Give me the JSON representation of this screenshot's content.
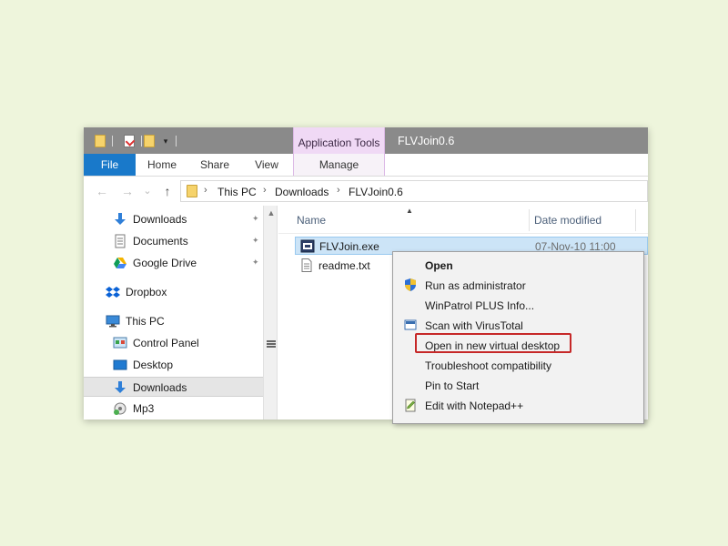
{
  "titlebar": {
    "context_tab_label": "Application Tools",
    "window_title": "FLVJoin0.6",
    "qat_dropdown_glyph": "▾",
    "qat_icons": [
      "folder-icon",
      "properties-icon",
      "new-folder-icon",
      "customize-dropdown-icon"
    ]
  },
  "ribbon": {
    "tabs": [
      {
        "label": "File",
        "active": true
      },
      {
        "label": "Home"
      },
      {
        "label": "Share"
      },
      {
        "label": "View"
      },
      {
        "label": "Manage"
      }
    ],
    "file_tab_color": "#1979ca",
    "context_tab_color": "#f0d9f5"
  },
  "nav": {
    "back_glyph": "←",
    "forward_glyph": "→",
    "recent_glyph": "⌄",
    "up_glyph": "↑",
    "breadcrumb": [
      "This PC",
      "Downloads",
      "FLVJoin0.6"
    ],
    "breadcrumb_separator": "›"
  },
  "navpane": {
    "pin_glyph": "📌",
    "items": [
      {
        "label": "Downloads",
        "icon": "download-arrow-icon",
        "pinned": true
      },
      {
        "label": "Documents",
        "icon": "document-icon",
        "pinned": true
      },
      {
        "label": "Google Drive",
        "icon": "google-drive-icon",
        "pinned": true
      },
      {
        "label": "Dropbox",
        "icon": "dropbox-icon"
      },
      {
        "label": "This PC",
        "icon": "computer-icon"
      },
      {
        "label": "Control Panel",
        "icon": "control-panel-icon"
      },
      {
        "label": "Desktop",
        "icon": "desktop-icon"
      },
      {
        "label": "Downloads",
        "icon": "download-arrow-icon",
        "selected": true
      },
      {
        "label": "Mp3",
        "icon": "music-icon"
      }
    ]
  },
  "filelist": {
    "columns": [
      "Name",
      "Date modified"
    ],
    "sort_glyph": "▲",
    "overflow_text": "A",
    "files": [
      {
        "name": "FLVJoin.exe",
        "date": "07-Nov-10 11:00",
        "icon": "exe-icon",
        "selected": true
      },
      {
        "name": "readme.txt",
        "date": "",
        "icon": "text-file-icon"
      }
    ]
  },
  "context_menu": {
    "items": [
      {
        "label": "Open",
        "bold": true,
        "icon": ""
      },
      {
        "label": "Run as administrator",
        "icon": "uac-shield-icon"
      },
      {
        "label": "WinPatrol PLUS Info...",
        "icon": ""
      },
      {
        "label": "Scan with VirusTotal",
        "icon": "virustotal-icon"
      },
      {
        "label": "Open in new virtual desktop",
        "icon": "",
        "highlighted": true
      },
      {
        "label": "Troubleshoot compatibility",
        "icon": ""
      },
      {
        "label": "Pin to Start",
        "icon": ""
      },
      {
        "label": "Edit with Notepad++",
        "icon": "notepad-plus-plus-icon"
      }
    ],
    "highlight_color": "#c62828"
  }
}
